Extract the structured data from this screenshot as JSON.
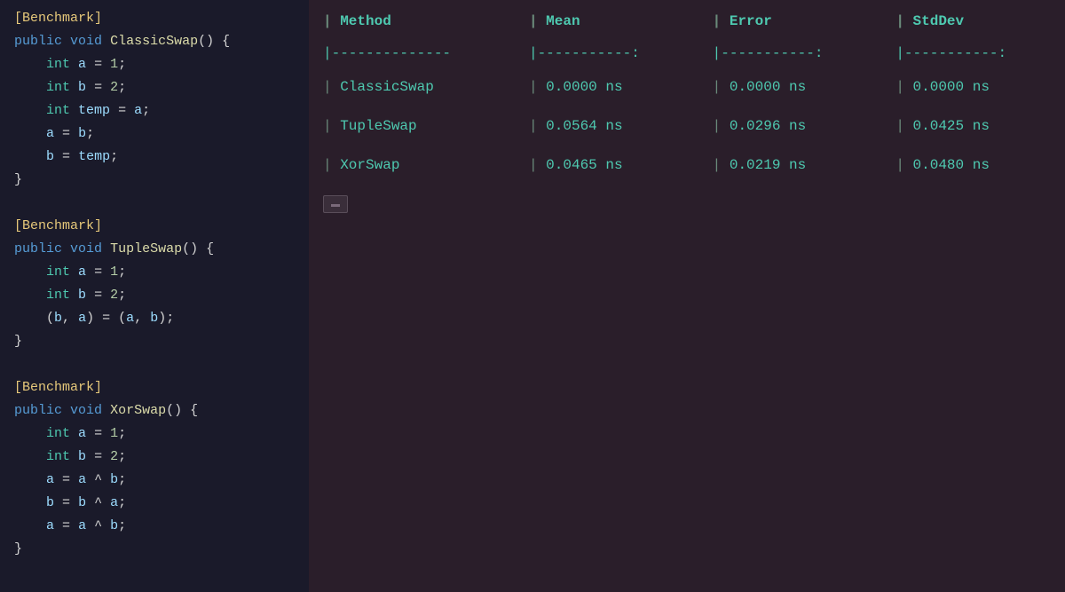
{
  "code": {
    "blocks": [
      {
        "id": "classicswap",
        "lines": [
          {
            "type": "benchmark",
            "text": "[Benchmark]"
          },
          {
            "type": "signature",
            "keyword": "public void ",
            "method": "ClassicSwap",
            "rest": "() {"
          },
          {
            "type": "var-decl",
            "indent": "    ",
            "kw": "int",
            "rest": " a = 1;"
          },
          {
            "type": "var-decl",
            "indent": "    ",
            "kw": "int",
            "rest": " b = 2;"
          },
          {
            "type": "var-decl",
            "indent": "    ",
            "kw": "int",
            "rest": " temp = a;"
          },
          {
            "type": "plain",
            "indent": "    ",
            "text": "a = b;"
          },
          {
            "type": "plain",
            "indent": "    ",
            "text": "b = temp;"
          },
          {
            "type": "brace",
            "text": "}"
          }
        ]
      },
      {
        "id": "tupleswap",
        "lines": [
          {
            "type": "benchmark",
            "text": "[Benchmark]"
          },
          {
            "type": "signature",
            "keyword": "public void ",
            "method": "TupleSwap",
            "rest": "() {"
          },
          {
            "type": "var-decl",
            "indent": "    ",
            "kw": "int",
            "rest": " a = 1;"
          },
          {
            "type": "var-decl",
            "indent": "    ",
            "kw": "int",
            "rest": " b = 2;"
          },
          {
            "type": "tuple",
            "indent": "    ",
            "text": "(b, a) = (a, b);"
          },
          {
            "type": "brace",
            "text": "}"
          }
        ]
      },
      {
        "id": "xorswap",
        "lines": [
          {
            "type": "benchmark",
            "text": "[Benchmark]"
          },
          {
            "type": "signature",
            "keyword": "public void ",
            "method": "XorSwap",
            "rest": "() {"
          },
          {
            "type": "var-decl",
            "indent": "    ",
            "kw": "int",
            "rest": " a = 1;"
          },
          {
            "type": "var-decl",
            "indent": "    ",
            "kw": "int",
            "rest": " b = 2;"
          },
          {
            "type": "plain",
            "indent": "    ",
            "text": "a = a ^ b;"
          },
          {
            "type": "plain",
            "indent": "    ",
            "text": "b = b ^ a;"
          },
          {
            "type": "plain",
            "indent": "    ",
            "text": "a = a ^ b;"
          },
          {
            "type": "brace",
            "text": "}"
          }
        ]
      }
    ]
  },
  "results": {
    "headers": [
      "Method",
      "Mean",
      "Error",
      "StdDev"
    ],
    "rows": [
      [
        "ClassicSwap",
        "0.0000 ns",
        "0.0000 ns",
        "0.0000 ns"
      ],
      [
        "TupleSwap",
        "0.0564 ns",
        "0.0296 ns",
        "0.0425 ns"
      ],
      [
        "XorSwap",
        "0.0465 ns",
        "0.0219 ns",
        "0.0480 ns"
      ]
    ]
  },
  "icons": {
    "terminal": "terminal-icon"
  }
}
